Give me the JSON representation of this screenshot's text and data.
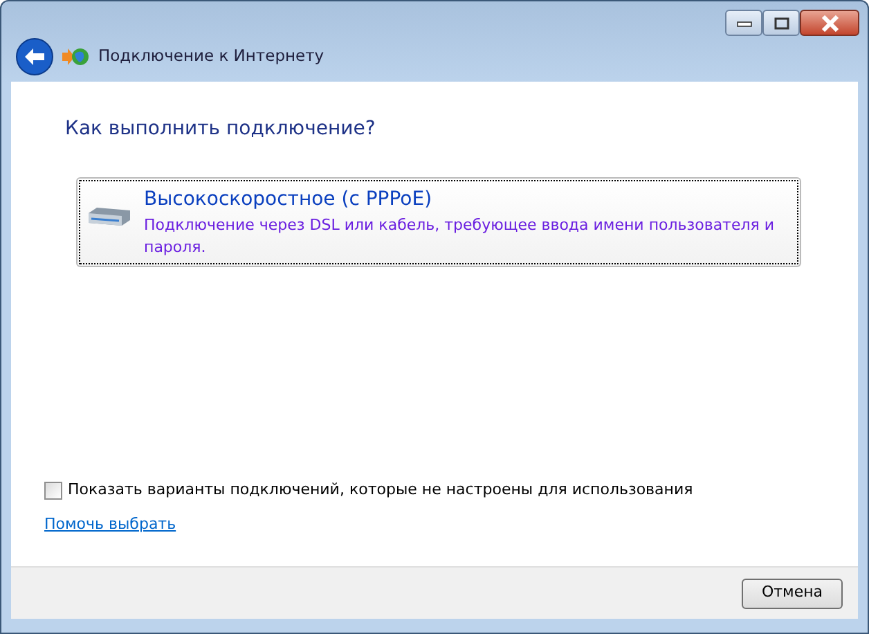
{
  "window": {
    "title": "Подключение к Интернету"
  },
  "heading": "Как выполнить подключение?",
  "options": [
    {
      "title": "Высокоскоростное (с PPPoE)",
      "description": "Подключение через DSL или кабель, требующее ввода имени пользователя и пароля.",
      "selected": true
    }
  ],
  "show_all": {
    "label": "Показать варианты подключений, которые не настроены для использования",
    "checked": false
  },
  "help_link": "Помочь выбрать",
  "buttons": [
    "Отмена"
  ]
}
